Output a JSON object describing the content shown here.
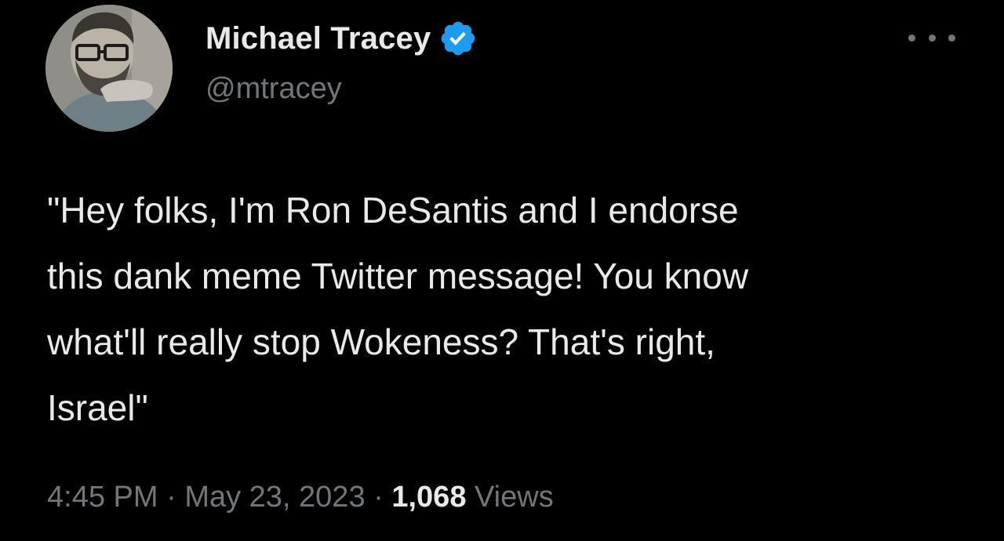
{
  "tweet": {
    "author": {
      "display_name": "Michael Tracey",
      "handle": "@mtracey",
      "verified": true,
      "verified_color": "#1d9bf0"
    },
    "more_menu_icon": "more-horizontal-icon",
    "text": "\"Hey folks, I'm Ron DeSantis and I endorse\nthis dank meme Twitter message! You know\nwhat'll really stop Wokeness? That's right,\nIsrael\"",
    "meta": {
      "time": "4:45 PM",
      "separator": "·",
      "date": "May 23, 2023",
      "views_count": "1,068",
      "views_label": "Views"
    }
  },
  "colors": {
    "background": "#000000",
    "primary_text": "#e7e9ea",
    "secondary_text": "#71767b"
  }
}
